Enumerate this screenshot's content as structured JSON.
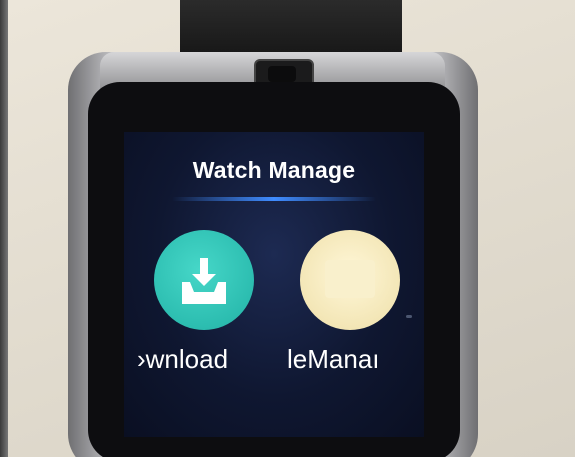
{
  "screen": {
    "title": "Watch Manage",
    "apps": [
      {
        "label": "›wnload",
        "icon": "download-tray-icon",
        "color": "#2cbdb0"
      },
      {
        "label": "leManaı",
        "icon": "folder-icon",
        "color": "#f3e6b6"
      }
    ]
  },
  "colors": {
    "screen_background": "#0f1731",
    "title_underline": "#3f8cff",
    "wall": "#e3ddd0",
    "watch_frame": "#2b2b2d"
  }
}
